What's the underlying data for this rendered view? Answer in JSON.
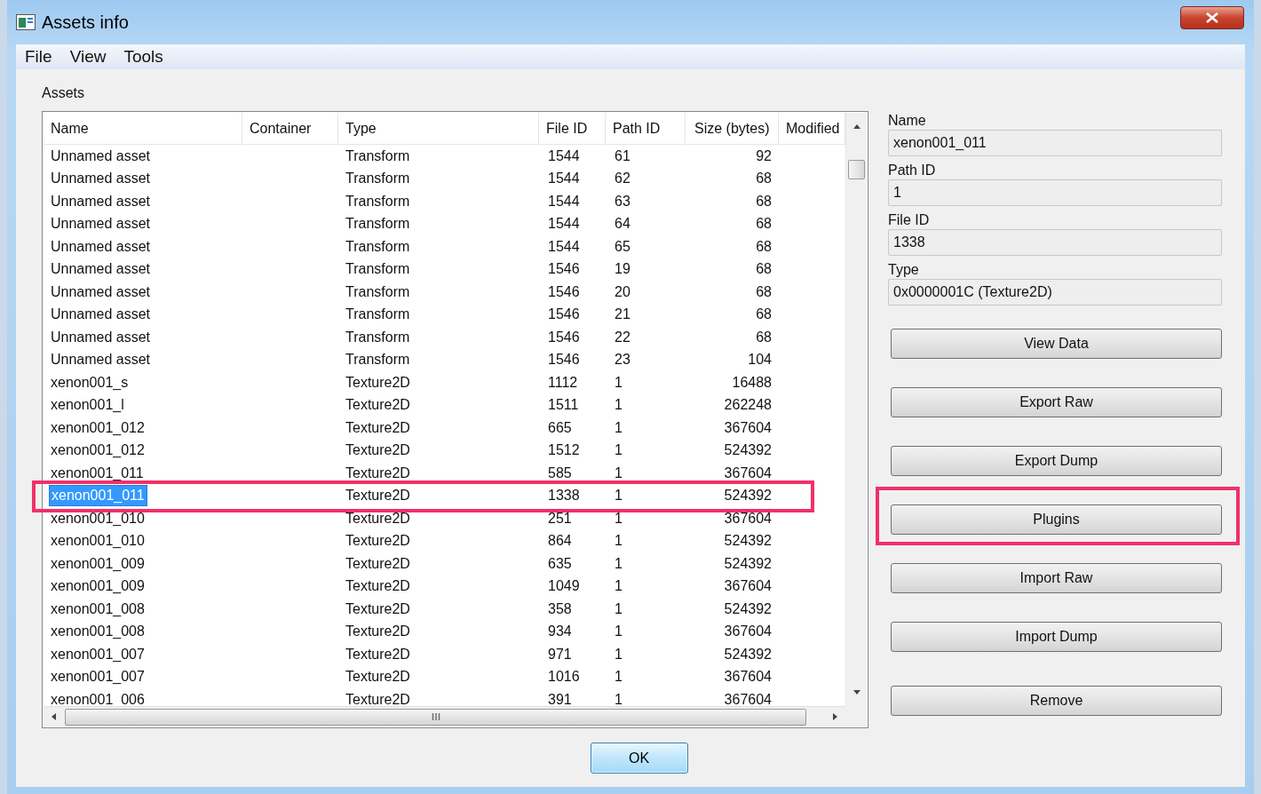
{
  "window": {
    "title": "Assets info"
  },
  "menu": [
    "File",
    "View",
    "Tools"
  ],
  "assets_label": "Assets",
  "table": {
    "columns": [
      "Name",
      "Container",
      "Type",
      "File ID",
      "Path ID",
      "Size (bytes)",
      "Modified"
    ],
    "rows": [
      {
        "name": "Unnamed asset",
        "container": "",
        "type": "Transform",
        "file_id": "1544",
        "path_id": "61",
        "size": "92",
        "selected": false,
        "highlighted": false
      },
      {
        "name": "Unnamed asset",
        "container": "",
        "type": "Transform",
        "file_id": "1544",
        "path_id": "62",
        "size": "68",
        "selected": false,
        "highlighted": false
      },
      {
        "name": "Unnamed asset",
        "container": "",
        "type": "Transform",
        "file_id": "1544",
        "path_id": "63",
        "size": "68",
        "selected": false,
        "highlighted": false
      },
      {
        "name": "Unnamed asset",
        "container": "",
        "type": "Transform",
        "file_id": "1544",
        "path_id": "64",
        "size": "68",
        "selected": false,
        "highlighted": false
      },
      {
        "name": "Unnamed asset",
        "container": "",
        "type": "Transform",
        "file_id": "1544",
        "path_id": "65",
        "size": "68",
        "selected": false,
        "highlighted": false
      },
      {
        "name": "Unnamed asset",
        "container": "",
        "type": "Transform",
        "file_id": "1546",
        "path_id": "19",
        "size": "68",
        "selected": false,
        "highlighted": false
      },
      {
        "name": "Unnamed asset",
        "container": "",
        "type": "Transform",
        "file_id": "1546",
        "path_id": "20",
        "size": "68",
        "selected": false,
        "highlighted": false
      },
      {
        "name": "Unnamed asset",
        "container": "",
        "type": "Transform",
        "file_id": "1546",
        "path_id": "21",
        "size": "68",
        "selected": false,
        "highlighted": false
      },
      {
        "name": "Unnamed asset",
        "container": "",
        "type": "Transform",
        "file_id": "1546",
        "path_id": "22",
        "size": "68",
        "selected": false,
        "highlighted": false
      },
      {
        "name": "Unnamed asset",
        "container": "",
        "type": "Transform",
        "file_id": "1546",
        "path_id": "23",
        "size": "104",
        "selected": false,
        "highlighted": false
      },
      {
        "name": "xenon001_s",
        "container": "",
        "type": "Texture2D",
        "file_id": "1112",
        "path_id": "1",
        "size": "16488",
        "selected": false,
        "highlighted": false
      },
      {
        "name": "xenon001_l",
        "container": "",
        "type": "Texture2D",
        "file_id": "1511",
        "path_id": "1",
        "size": "262248",
        "selected": false,
        "highlighted": false
      },
      {
        "name": "xenon001_012",
        "container": "",
        "type": "Texture2D",
        "file_id": "665",
        "path_id": "1",
        "size": "367604",
        "selected": false,
        "highlighted": false
      },
      {
        "name": "xenon001_012",
        "container": "",
        "type": "Texture2D",
        "file_id": "1512",
        "path_id": "1",
        "size": "524392",
        "selected": false,
        "highlighted": false
      },
      {
        "name": "xenon001_011",
        "container": "",
        "type": "Texture2D",
        "file_id": "585",
        "path_id": "1",
        "size": "367604",
        "selected": false,
        "highlighted": false
      },
      {
        "name": "xenon001_011",
        "container": "",
        "type": "Texture2D",
        "file_id": "1338",
        "path_id": "1",
        "size": "524392",
        "selected": true,
        "highlighted": true
      },
      {
        "name": "xenon001_010",
        "container": "",
        "type": "Texture2D",
        "file_id": "251",
        "path_id": "1",
        "size": "367604",
        "selected": false,
        "highlighted": false
      },
      {
        "name": "xenon001_010",
        "container": "",
        "type": "Texture2D",
        "file_id": "864",
        "path_id": "1",
        "size": "524392",
        "selected": false,
        "highlighted": false
      },
      {
        "name": "xenon001_009",
        "container": "",
        "type": "Texture2D",
        "file_id": "635",
        "path_id": "1",
        "size": "524392",
        "selected": false,
        "highlighted": false
      },
      {
        "name": "xenon001_009",
        "container": "",
        "type": "Texture2D",
        "file_id": "1049",
        "path_id": "1",
        "size": "367604",
        "selected": false,
        "highlighted": false
      },
      {
        "name": "xenon001_008",
        "container": "",
        "type": "Texture2D",
        "file_id": "358",
        "path_id": "1",
        "size": "524392",
        "selected": false,
        "highlighted": false
      },
      {
        "name": "xenon001_008",
        "container": "",
        "type": "Texture2D",
        "file_id": "934",
        "path_id": "1",
        "size": "367604",
        "selected": false,
        "highlighted": false
      },
      {
        "name": "xenon001_007",
        "container": "",
        "type": "Texture2D",
        "file_id": "971",
        "path_id": "1",
        "size": "524392",
        "selected": false,
        "highlighted": false
      },
      {
        "name": "xenon001_007",
        "container": "",
        "type": "Texture2D",
        "file_id": "1016",
        "path_id": "1",
        "size": "367604",
        "selected": false,
        "highlighted": false
      },
      {
        "name": "xenon001_006",
        "container": "",
        "type": "Texture2D",
        "file_id": "391",
        "path_id": "1",
        "size": "367604",
        "selected": false,
        "highlighted": false
      }
    ]
  },
  "details": [
    {
      "label": "Name",
      "value": "xenon001_011"
    },
    {
      "label": "Path ID",
      "value": "1"
    },
    {
      "label": "File ID",
      "value": "1338"
    },
    {
      "label": "Type",
      "value": "0x0000001C (Texture2D)"
    }
  ],
  "buttons": [
    {
      "label": "View Data",
      "highlighted": false
    },
    {
      "label": "Export Raw",
      "highlighted": false
    },
    {
      "label": "Export Dump",
      "highlighted": false
    },
    {
      "label": "Plugins",
      "highlighted": true
    },
    {
      "label": "Import Raw",
      "highlighted": false
    },
    {
      "label": "Import Dump",
      "highlighted": false
    },
    {
      "label": "Remove",
      "highlighted": false
    }
  ],
  "ok_button": "OK"
}
